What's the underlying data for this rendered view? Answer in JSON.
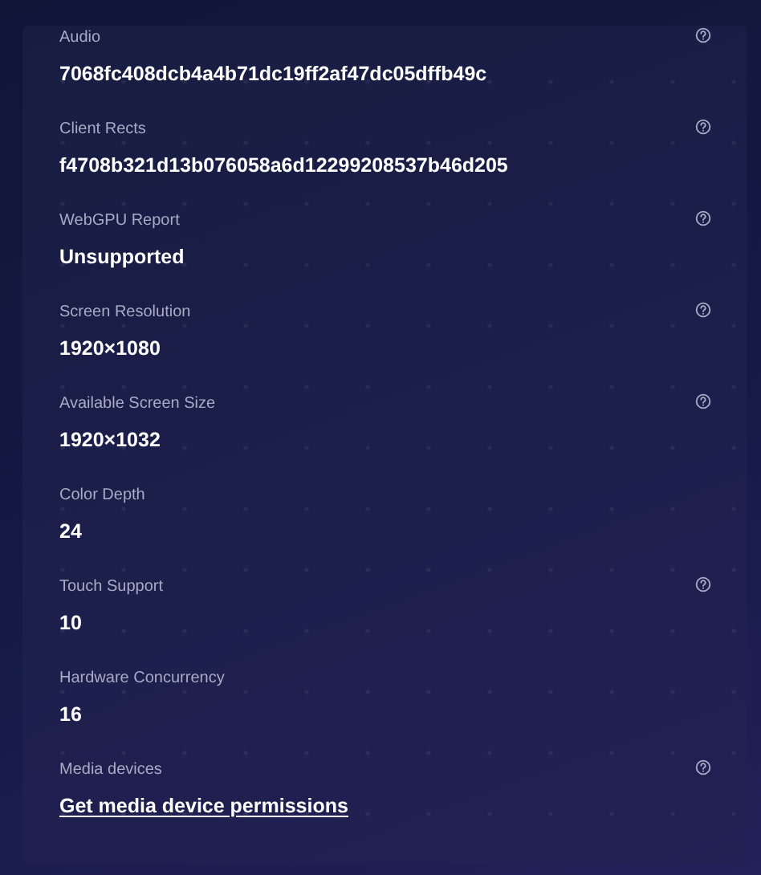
{
  "fields": [
    {
      "label": "Audio",
      "value": "7068fc408dcb4a4b71dc19ff2af47dc05dffb49c",
      "kind": "text",
      "help": true
    },
    {
      "label": "Client Rects",
      "value": "f4708b321d13b076058a6d12299208537b46d205",
      "kind": "text",
      "help": true
    },
    {
      "label": "WebGPU Report",
      "value": "Unsupported",
      "kind": "text",
      "help": true
    },
    {
      "label": "Screen Resolution",
      "value": "1920×1080",
      "kind": "text",
      "help": true
    },
    {
      "label": "Available Screen Size",
      "value": "1920×1032",
      "kind": "text",
      "help": true
    },
    {
      "label": "Color Depth",
      "value": "24",
      "kind": "text",
      "help": false
    },
    {
      "label": "Touch Support",
      "value": "10",
      "kind": "text",
      "help": true
    },
    {
      "label": "Hardware Concurrency",
      "value": "16",
      "kind": "text",
      "help": false
    },
    {
      "label": "Media devices",
      "value": "Get media device permissions",
      "kind": "link",
      "help": true
    }
  ]
}
